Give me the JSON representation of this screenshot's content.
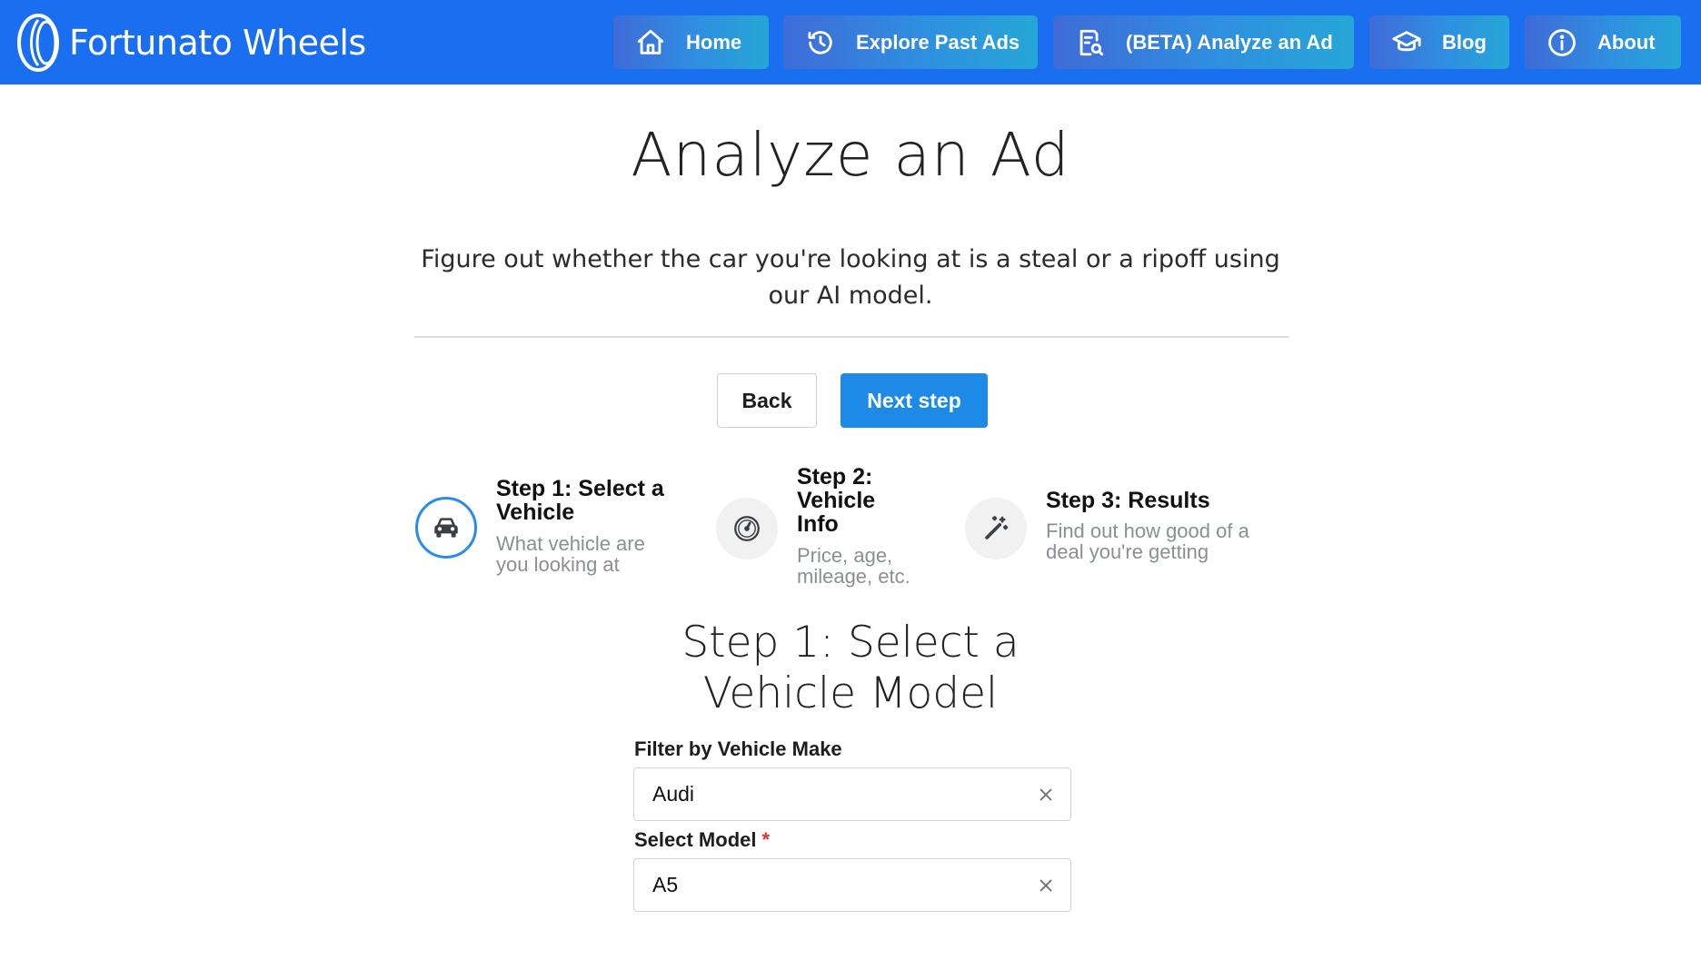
{
  "nav": {
    "brand": "Fortunato Wheels",
    "items": [
      {
        "label": "Home",
        "icon": "home-icon"
      },
      {
        "label": "Explore Past Ads",
        "icon": "history-icon"
      },
      {
        "label": "(BETA) Analyze an Ad",
        "icon": "report-search-icon"
      },
      {
        "label": "Blog",
        "icon": "school-icon"
      },
      {
        "label": "About",
        "icon": "info-icon"
      }
    ]
  },
  "page": {
    "title": "Analyze an Ad",
    "intro": "Figure out whether the car you're looking at is a steal or a ripoff using our AI model."
  },
  "actions": {
    "back": "Back",
    "next": "Next step"
  },
  "steps": [
    {
      "title": "Step 1: Select a Vehicle",
      "description": "What vehicle are you looking at",
      "icon": "car-icon",
      "active": true
    },
    {
      "title": "Step 2: Vehicle Info",
      "description": "Price, age, mileage, etc.",
      "icon": "gauge-icon",
      "active": false
    },
    {
      "title": "Step 3: Results",
      "description": "Find out how good of a deal you're getting",
      "icon": "magic-wand-icon",
      "active": false
    }
  ],
  "form": {
    "section_title": "Step 1: Select a Vehicle Model",
    "make_label": "Filter by Vehicle Make",
    "make_value": "Audi",
    "model_label": "Select Model",
    "model_required_mark": "*",
    "model_value": "A5"
  },
  "colors": {
    "navbar": "#1a6ef0",
    "primary": "#1d8ae7",
    "active_step_ring": "#2a8be8",
    "required": "#e03131"
  }
}
